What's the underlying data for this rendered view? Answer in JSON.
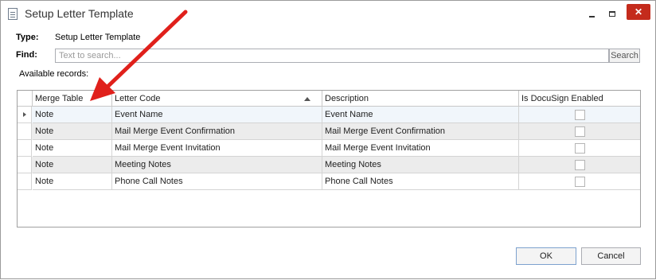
{
  "window": {
    "title": "Setup Letter Template",
    "title_icon": "document-icon",
    "controls": {
      "minimize": "minimize-icon",
      "maximize": "maximize-icon",
      "close": "✕"
    }
  },
  "form": {
    "type_label": "Type:",
    "type_value": "Setup Letter Template",
    "find_label": "Find:",
    "search_placeholder": "Text to search...",
    "search_value": "",
    "search_button": "Search",
    "available_records_label": "Available records:"
  },
  "grid": {
    "columns": [
      "Merge Table",
      "Letter Code",
      "Description",
      "Is DocuSign Enabled"
    ],
    "sorted_column": "Letter Code",
    "sort_direction": "ascending",
    "rows": [
      {
        "merge_table": "Note",
        "letter_code": "Event Name",
        "description": "Event Name",
        "docusign_enabled": false
      },
      {
        "merge_table": "Note",
        "letter_code": "Mail Merge Event Confirmation",
        "description": "Mail Merge Event Confirmation",
        "docusign_enabled": false
      },
      {
        "merge_table": "Note",
        "letter_code": "Mail Merge Event Invitation",
        "description": "Mail Merge Event Invitation",
        "docusign_enabled": false
      },
      {
        "merge_table": "Note",
        "letter_code": "Meeting Notes",
        "description": "Meeting Notes",
        "docusign_enabled": false
      },
      {
        "merge_table": "Note",
        "letter_code": "Phone Call Notes",
        "description": "Phone Call Notes",
        "docusign_enabled": false
      }
    ]
  },
  "buttons": {
    "ok": "OK",
    "cancel": "Cancel"
  },
  "annotation": {
    "arrow_color": "#e0201b"
  }
}
